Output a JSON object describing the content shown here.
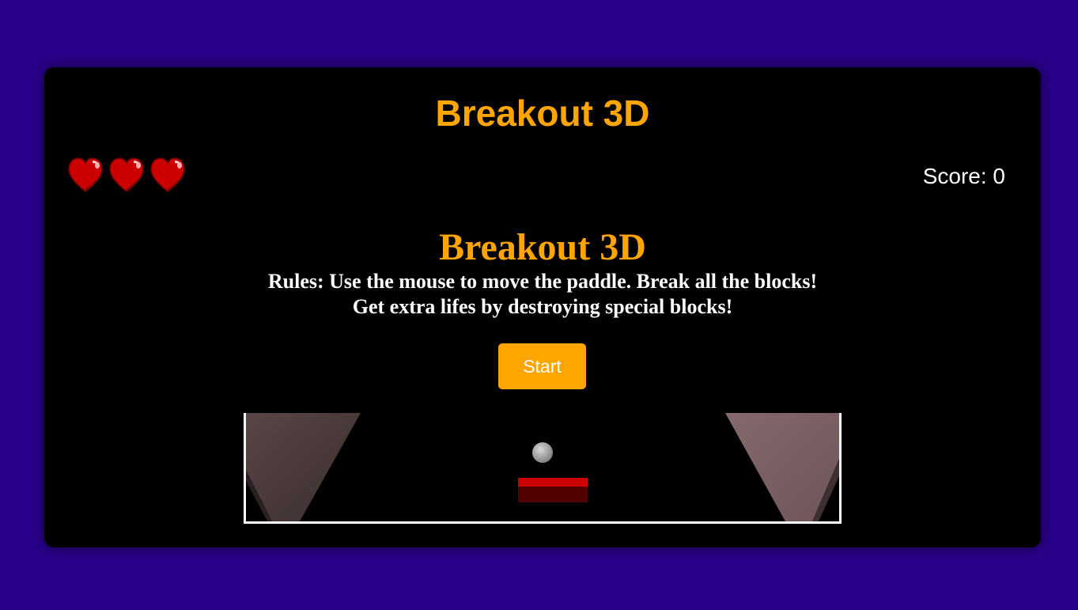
{
  "header": {
    "title": "Breakout 3D"
  },
  "hud": {
    "lives": 3,
    "life_icon": "heart-icon",
    "score_text": "Score: 0"
  },
  "start_screen": {
    "title": "Breakout 3D",
    "rules_line1": "Rules: Use the mouse to move the paddle. Break all the blocks!",
    "rules_line2": "Get extra lifes by destroying special blocks!",
    "start_label": "Start"
  },
  "colors": {
    "page_background": "#29008a",
    "accent": "#ffa500",
    "card_background": "#000000",
    "heart": "#cc0000",
    "paddle": "#cc0000"
  }
}
